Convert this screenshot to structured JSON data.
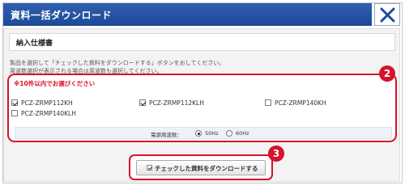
{
  "dialog": {
    "title": "資料一括ダウンロード",
    "close_icon": "close-icon"
  },
  "spec": {
    "title": "納入仕様書"
  },
  "instructions": [
    "製品を選択して「チェックした資料をダウンロードする」ボタンをおしてください。",
    "周波数選択が表示される場合は周波数も選択してください。"
  ],
  "selection": {
    "warning": "※10件以内でお選びください",
    "items": [
      {
        "label": "PCZ-ZRMP112KH",
        "checked": true
      },
      {
        "label": "PCZ-ZRMP112KLH",
        "checked": true
      },
      {
        "label": "PCZ-ZRMP140KH",
        "checked": false
      },
      {
        "label": "PCZ-ZRMP140KLH",
        "checked": false
      }
    ],
    "frequency": {
      "label": "電源周波数：",
      "options": [
        {
          "label": "50Hz",
          "selected": true
        },
        {
          "label": "60Hz",
          "selected": false
        }
      ]
    }
  },
  "callouts": {
    "selection_number": "2",
    "download_number": "3"
  },
  "download": {
    "label": "チェックした資料をダウンロードする"
  },
  "colors": {
    "title_bar": "#1d4a98",
    "highlight": "#d7122a"
  }
}
